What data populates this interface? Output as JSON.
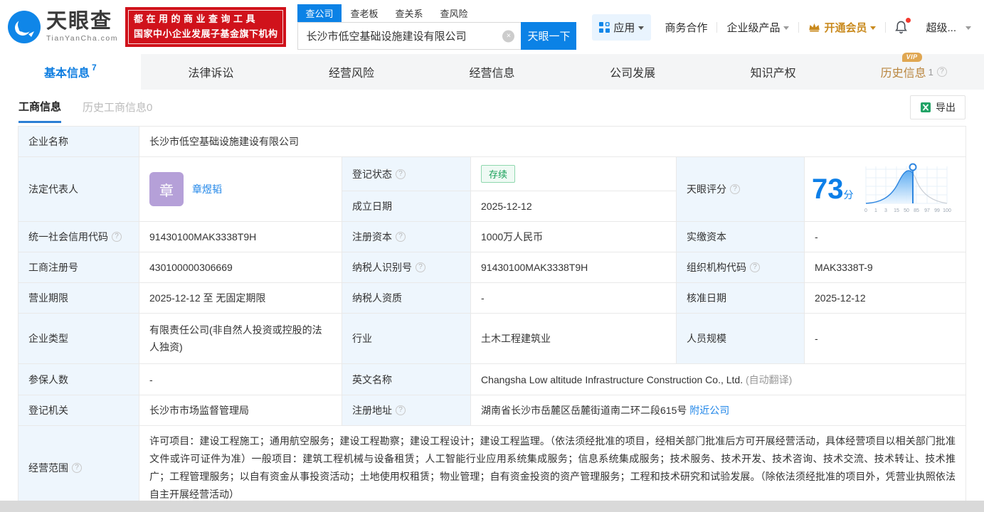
{
  "header": {
    "logo": {
      "brand": "天眼查",
      "domain": "TianYanCha.com"
    },
    "promo": {
      "line1": "都在用的商业查询工具",
      "line2": "国家中小企业发展子基金旗下机构"
    },
    "search": {
      "tabs": [
        {
          "label": "查公司"
        },
        {
          "label": "查老板"
        },
        {
          "label": "查关系"
        },
        {
          "label": "查风险"
        }
      ],
      "value": "长沙市低空基础设施建设有限公司",
      "button": "天眼一下"
    },
    "nav": {
      "apps": "应用",
      "biz": "商务合作",
      "enterprise": "企业级产品",
      "vip": "开通会员",
      "user": "超级..."
    }
  },
  "tabs": [
    {
      "label": "基本信息",
      "count": "7"
    },
    {
      "label": "法律诉讼"
    },
    {
      "label": "经营风险"
    },
    {
      "label": "经营信息"
    },
    {
      "label": "公司发展"
    },
    {
      "label": "知识产权"
    },
    {
      "label": "历史信息",
      "count": "1",
      "vip_badge": "VIP"
    }
  ],
  "subtabs": {
    "active": "工商信息",
    "inactive": "历史工商信息0",
    "export": "导出"
  },
  "icons": {
    "clear": "×",
    "help": "?"
  },
  "score": {
    "label": "天眼评分",
    "value": "73",
    "unit": "分",
    "ticks": [
      "0",
      "1",
      "3",
      "15",
      "50",
      "85",
      "97",
      "99",
      "100"
    ]
  },
  "table": {
    "company_name_label": "企业名称",
    "company_name": "长沙市低空基础设施建设有限公司",
    "legal_rep_label": "法定代表人",
    "legal_rep_avatar": "章",
    "legal_rep_name": "章煜韬",
    "reg_status_label": "登记状态",
    "reg_status": "存续",
    "establish_date_label": "成立日期",
    "establish_date": "2025-12-12",
    "credit_code_label": "统一社会信用代码",
    "credit_code": "91430100MAK3338T9H",
    "reg_capital_label": "注册资本",
    "reg_capital": "1000万人民币",
    "paid_capital_label": "实缴资本",
    "paid_capital": "-",
    "reg_number_label": "工商注册号",
    "reg_number": "430100000306669",
    "taxpayer_id_label": "纳税人识别号",
    "taxpayer_id": "91430100MAK3338T9H",
    "org_code_label": "组织机构代码",
    "org_code": "MAK3338T-9",
    "business_term_label": "营业期限",
    "business_term": "2025-12-12 至 无固定期限",
    "taxpayer_quality_label": "纳税人资质",
    "taxpayer_quality": "-",
    "approval_date_label": "核准日期",
    "approval_date": "2025-12-12",
    "company_type_label": "企业类型",
    "company_type": "有限责任公司(非自然人投资或控股的法人独资)",
    "industry_label": "行业",
    "industry": "土木工程建筑业",
    "staff_size_label": "人员规模",
    "staff_size": "-",
    "insured_label": "参保人数",
    "insured": "-",
    "english_name_label": "英文名称",
    "english_name": "Changsha Low altitude Infrastructure Construction Co., Ltd.",
    "english_name_note": "(自动翻译)",
    "reg_authority_label": "登记机关",
    "reg_authority": "长沙市市场监督管理局",
    "address_label": "注册地址",
    "address": "湖南省长沙市岳麓区岳麓街道南二环二段615号",
    "address_link": "附近公司",
    "business_scope_label": "经营范围",
    "business_scope": "许可项目：建设工程施工；通用航空服务；建设工程勘察；建设工程设计；建设工程监理。（依法须经批准的项目，经相关部门批准后方可开展经营活动，具体经营项目以相关部门批准文件或许可证件为准）一般项目：建筑工程机械与设备租赁；人工智能行业应用系统集成服务；信息系统集成服务；技术服务、技术开发、技术咨询、技术交流、技术转让、技术推广；工程管理服务；以自有资金从事投资活动；土地使用权租赁；物业管理；自有资金投资的资产管理服务；工程和技术研究和试验发展。（除依法须经批准的项目外，凭营业执照依法自主开展经营活动）"
  },
  "colors": {
    "accent_blue": "#0b82e6",
    "promo_red": "#d0121b",
    "status_green": "#18a058",
    "vip_gold": "#c98a1e",
    "label_bg": "#eef6fd"
  }
}
